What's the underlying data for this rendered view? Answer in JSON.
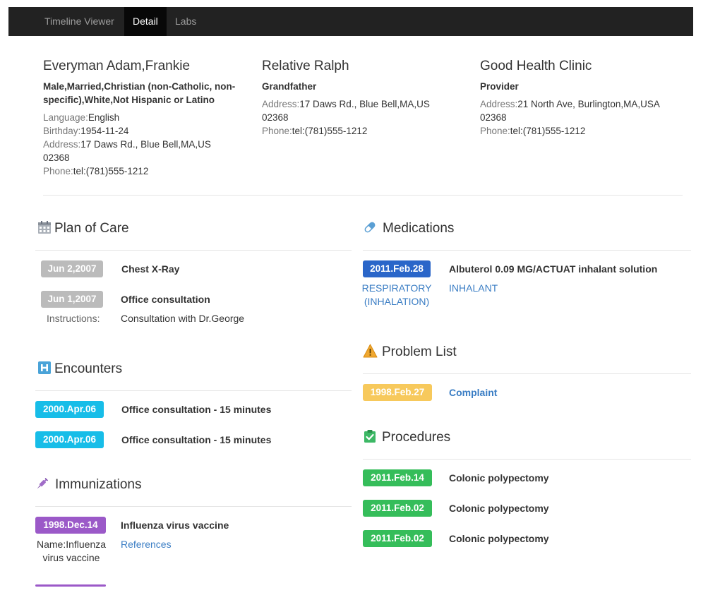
{
  "nav": {
    "items": [
      {
        "label": "Timeline Viewer"
      },
      {
        "label": "Detail"
      },
      {
        "label": "Labs"
      }
    ]
  },
  "patient": {
    "name": "Everyman Adam,Frankie",
    "demographics": "Male,Married,Christian (non-Catholic, non-specific),White,Not Hispanic or Latino",
    "language_label": "Language:",
    "language": "English",
    "birthday_label": "Birthday:",
    "birthday": "1954-11-24",
    "address_label": "Address:",
    "address_line1": "17 Daws Rd., Blue Bell,MA,US",
    "address_line2": "02368",
    "phone_label": "Phone:",
    "phone": "tel:(781)555-1212"
  },
  "relative": {
    "name": "Relative Ralph",
    "relation": "Grandfather",
    "address_label": "Address:",
    "address_line1": "17 Daws Rd., Blue Bell,MA,US",
    "address_line2": "02368",
    "phone_label": "Phone:",
    "phone": "tel:(781)555-1212"
  },
  "provider": {
    "name": "Good Health Clinic",
    "role": "Provider",
    "address_label": "Address:",
    "address_line1": "21 North Ave, Burlington,MA,USA",
    "address_line2": "02368",
    "phone_label": "Phone:",
    "phone": "tel:(781)555-1212"
  },
  "plan_of_care": {
    "title": "Plan of Care",
    "items": [
      {
        "date": "Jun 2,2007",
        "label": "Chest X-Ray"
      },
      {
        "date": "Jun 1,2007",
        "label": "Office consultation",
        "instructions_label": "Instructions:",
        "instructions": "Consultation with Dr.George"
      }
    ]
  },
  "encounters": {
    "title": "Encounters",
    "items": [
      {
        "date": "2000.Apr.06",
        "label": "Office consultation - 15 minutes"
      },
      {
        "date": "2000.Apr.06",
        "label": "Office consultation - 15 minutes"
      }
    ]
  },
  "immunizations": {
    "title": "Immunizations",
    "items": [
      {
        "date": "1998.Dec.14",
        "label": "Influenza virus vaccine",
        "name_line1": "Name:Influenza",
        "name_line2": "virus vaccine",
        "link": "References"
      }
    ]
  },
  "medications": {
    "title": "Medications",
    "items": [
      {
        "date": "2011.Feb.28",
        "label": "Albuterol 0.09 MG/ACTUAT inhalant solution",
        "route_line1": "RESPIRATORY",
        "route_line2": "(INHALATION)",
        "form": "INHALANT"
      }
    ]
  },
  "problem_list": {
    "title": "Problem List",
    "items": [
      {
        "date": "1998.Feb.27",
        "label": "Complaint"
      }
    ]
  },
  "procedures": {
    "title": "Procedures",
    "items": [
      {
        "date": "2011.Feb.14",
        "label": "Colonic polypectomy"
      },
      {
        "date": "2011.Feb.02",
        "label": "Colonic polypectomy"
      },
      {
        "date": "2011.Feb.02",
        "label": "Colonic polypectomy"
      }
    ]
  },
  "icons": {
    "plan_of_care": "calendar-icon",
    "encounters": "hospital-icon",
    "immunizations": "syringe-icon",
    "medications": "pill-icon",
    "problem_list": "warning-icon",
    "procedures": "clipboard-check-icon"
  },
  "colors": {
    "navbar": "#222222",
    "badge_gray": "#bbbbbb",
    "badge_cyan": "#17bde8",
    "badge_purple": "#9b59c8",
    "badge_blue": "#2a66c9",
    "badge_yellow": "#f7c95c",
    "badge_green": "#35bd5a",
    "link": "#3a7dc4"
  }
}
